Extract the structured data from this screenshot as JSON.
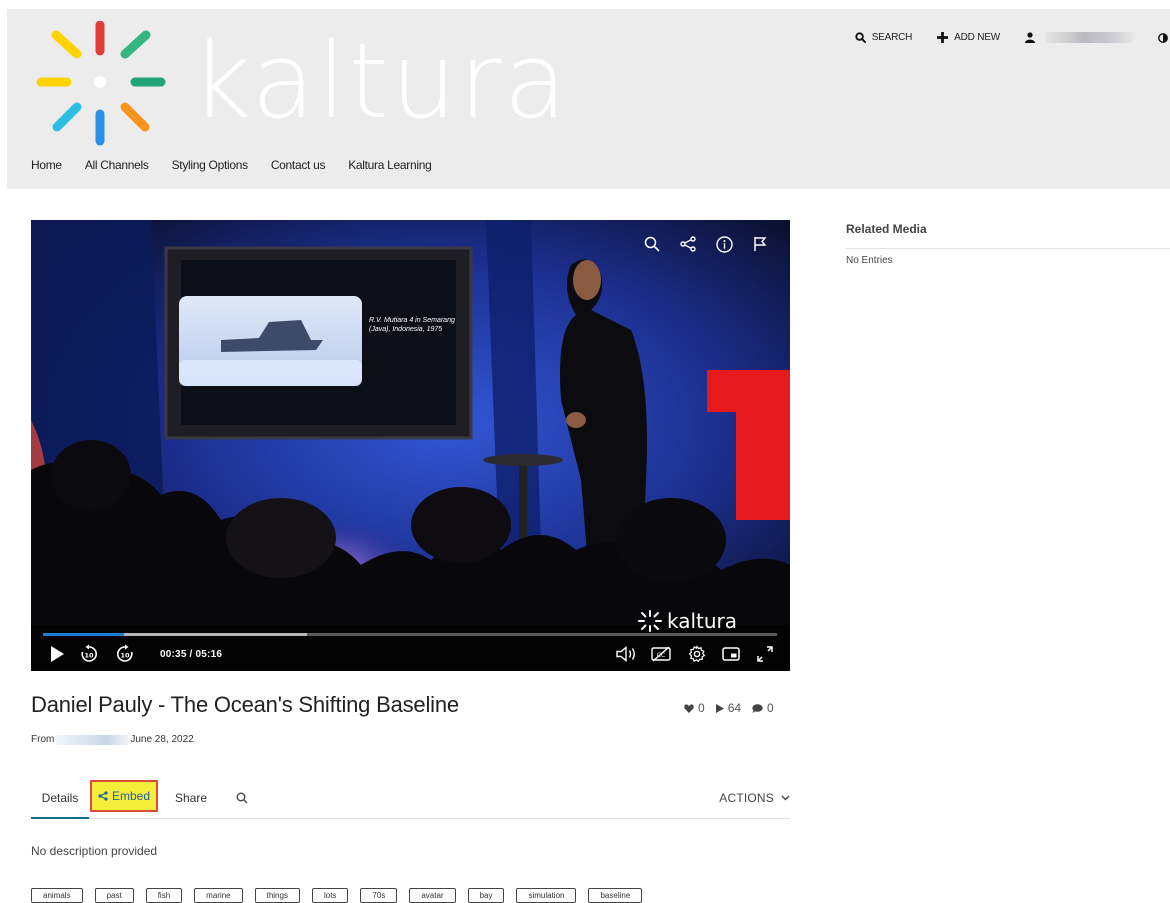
{
  "brand": {
    "name": "kaltura",
    "colors": {
      "red": "#e23b3b",
      "orange": "#f7941d",
      "yellow": "#ffd200",
      "green": "#33b680",
      "blue": "#2b8fe8",
      "cyan": "#2bc0e4"
    }
  },
  "header": {
    "nav": [
      {
        "label": "Home"
      },
      {
        "label": "All Channels"
      },
      {
        "label": "Styling Options"
      },
      {
        "label": "Contact us"
      },
      {
        "label": "Kaltura Learning"
      }
    ],
    "search_label": "SEARCH",
    "add_new_label": "ADD NEW"
  },
  "player": {
    "time": "00:35 / 05:16",
    "progress": 0.11,
    "buffered": 0.36,
    "slide_caption": "R.V. Mutiara 4 in Semarang (Java), Indonesia, 1975",
    "watermark": "kaltura"
  },
  "media": {
    "title": "Daniel Pauly - The Ocean's Shifting Baseline",
    "likes": "0",
    "plays": "64",
    "comments": "0",
    "from_label": "From",
    "date": "June 28, 2022",
    "description": "No description provided",
    "tags": [
      "animals",
      "past",
      "fish",
      "marine",
      "things",
      "lots",
      "70s",
      "avatar",
      "bay",
      "simulation",
      "baseline"
    ]
  },
  "tabs": {
    "details": "Details",
    "embed": "Embed",
    "share": "Share",
    "actions": "ACTIONS"
  },
  "related": {
    "title": "Related Media",
    "empty": "No Entries"
  }
}
